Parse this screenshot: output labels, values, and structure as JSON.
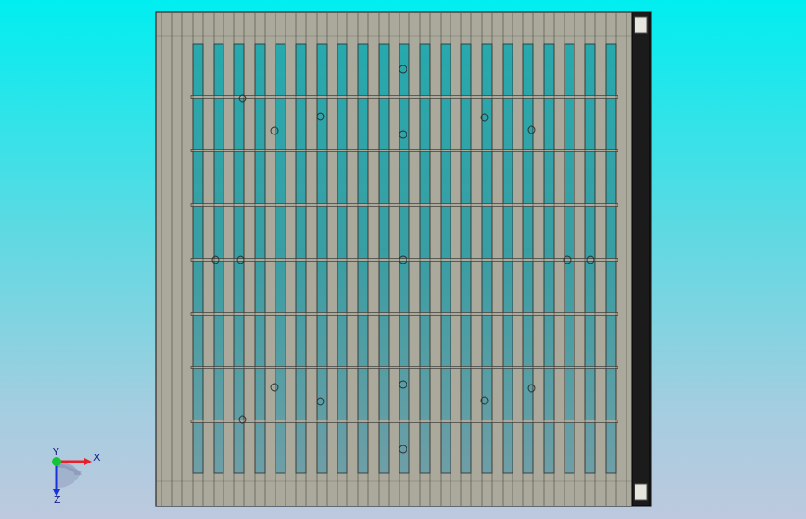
{
  "viewport": {
    "background_top": "#00eef0",
    "background_bottom": "#bdc9de"
  },
  "model": {
    "frame_color": "#aaa99b",
    "slot_color": "#2aa0a6",
    "edge_color": "#2a2a2a",
    "rail_color": "#1b1b1b",
    "latch_color": "#e6e6df"
  },
  "triad": {
    "x_label": "X",
    "z_label": "Z",
    "y_label": "Y",
    "x_color": "#e8202a",
    "y_color": "#16c43a",
    "z_color": "#1a32d8"
  }
}
